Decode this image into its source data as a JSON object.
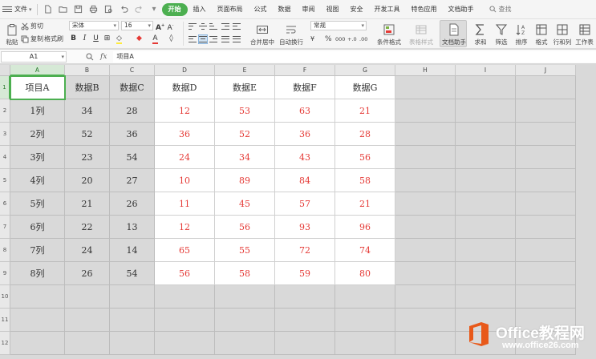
{
  "menubar": {
    "file_label": "文件",
    "tabs": [
      {
        "label": "开始",
        "active": true
      },
      {
        "label": "插入"
      },
      {
        "label": "页面布局"
      },
      {
        "label": "公式"
      },
      {
        "label": "数据"
      },
      {
        "label": "审阅"
      },
      {
        "label": "视图"
      },
      {
        "label": "安全"
      },
      {
        "label": "开发工具"
      },
      {
        "label": "特色应用"
      },
      {
        "label": "文档助手"
      }
    ],
    "search_label": "查找"
  },
  "ribbon": {
    "paste": "粘贴",
    "cut": "剪切",
    "copy": "复制",
    "format_painter": "格式刷",
    "font_name": "宋体",
    "font_size": "16",
    "merge_center": "合并居中",
    "wrap_text": "自动换行",
    "number_format": "常规",
    "conditional_format": "条件格式",
    "table_style": "表格样式",
    "doc_assistant": "文档助手",
    "sum": "求和",
    "filter": "筛选",
    "sort": "排序",
    "format": "格式",
    "row_col": "行和列",
    "worksheet": "工作表",
    "percent": "%",
    "thousands": "000",
    "dec_inc": "+.0",
    "dec_dec": ".00"
  },
  "formula_bar": {
    "cell_ref": "A1",
    "fx": "fx",
    "content": "项目A"
  },
  "sheet": {
    "columns": [
      "A",
      "B",
      "C",
      "D",
      "E",
      "F",
      "G",
      "H",
      "I",
      "J"
    ],
    "rows": [
      "1",
      "2",
      "3",
      "4",
      "5",
      "6",
      "7",
      "8",
      "9",
      "10",
      "11",
      "12"
    ],
    "header_row": [
      "项目A",
      "数据B",
      "数据C",
      "数据D",
      "数据E",
      "数据F",
      "数据G"
    ],
    "data_rows": [
      [
        "1列",
        "34",
        "28",
        "12",
        "53",
        "63",
        "21"
      ],
      [
        "2列",
        "52",
        "36",
        "36",
        "52",
        "36",
        "28"
      ],
      [
        "3列",
        "23",
        "54",
        "24",
        "34",
        "43",
        "56"
      ],
      [
        "4列",
        "20",
        "27",
        "10",
        "89",
        "84",
        "58"
      ],
      [
        "5列",
        "21",
        "26",
        "11",
        "45",
        "57",
        "21"
      ],
      [
        "6列",
        "22",
        "13",
        "12",
        "56",
        "93",
        "96"
      ],
      [
        "7列",
        "24",
        "14",
        "65",
        "55",
        "72",
        "74"
      ],
      [
        "8列",
        "26",
        "54",
        "56",
        "58",
        "59",
        "80"
      ]
    ],
    "colors": {
      "gray_fill": "#d9d9d9",
      "white_fill": "#ffffff",
      "red_text": "#e53935",
      "accent": "#4caf50"
    }
  },
  "watermark": {
    "title": "Office教程网",
    "url": "www.office26.com",
    "logo_color": "#e8591a"
  }
}
